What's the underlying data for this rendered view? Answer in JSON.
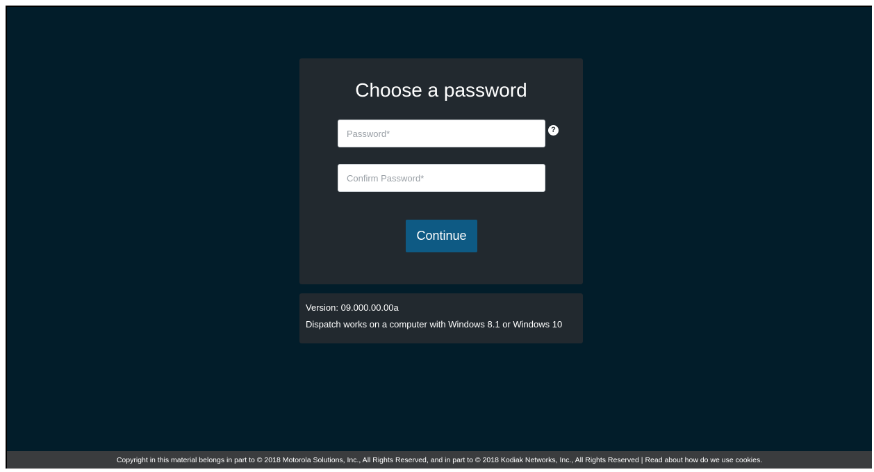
{
  "card": {
    "title": "Choose a password",
    "password_placeholder": "Password*",
    "confirm_placeholder": "Confirm Password*",
    "help_icon": "?",
    "continue_label": "Continue"
  },
  "info": {
    "version": "Version: 09.000.00.00a",
    "requirement": "Dispatch works on a computer with Windows 8.1 or Windows 10"
  },
  "footer": {
    "copyright": "Copyright in this material belongs in part to © 2018 Motorola Solutions, Inc., All Rights Reserved, and in part to © 2018 Kodiak Networks, Inc., All Rights Reserved | ",
    "cookies_link": "Read about how do we use cookies."
  },
  "colors": {
    "background": "#021d2a",
    "card": "#22292f",
    "button": "#0e5a84",
    "footer": "#3a3c3e"
  },
  "icons": {
    "help": "question-circle-icon"
  }
}
